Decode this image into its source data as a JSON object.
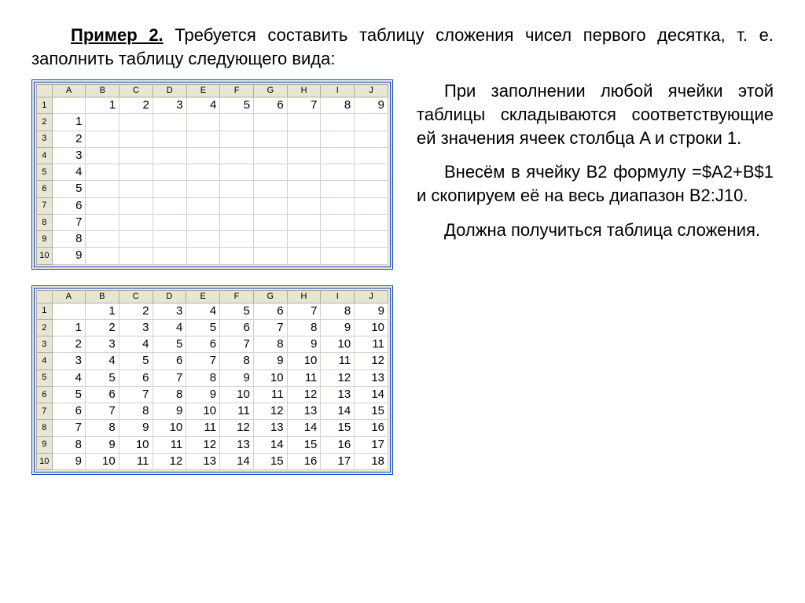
{
  "intro": {
    "example_label": "Пример 2.",
    "text": " Требуется составить таблицу сложения чисел первого десятка, т. е. заполнить таблицу следующего вида:"
  },
  "para1": "При заполнении любой ячейки этой таблицы складываются соответствующие ей значения ячеек столбца A и строки 1.",
  "para2": "Внесём в ячейку B2 формулу =$A2+B$1 и скопируем её на весь диапазон B2:J10.",
  "para3": "Должна получиться таблица сложения.",
  "table1": {
    "columns": [
      "",
      "A",
      "B",
      "C",
      "D",
      "E",
      "F",
      "G",
      "H",
      "I",
      "J"
    ],
    "rows": [
      {
        "h": "1",
        "cells": [
          "",
          "1",
          "2",
          "3",
          "4",
          "5",
          "6",
          "7",
          "8",
          "9"
        ]
      },
      {
        "h": "2",
        "cells": [
          "1",
          "",
          "",
          "",
          "",
          "",
          "",
          "",
          "",
          ""
        ]
      },
      {
        "h": "3",
        "cells": [
          "2",
          "",
          "",
          "",
          "",
          "",
          "",
          "",
          "",
          ""
        ]
      },
      {
        "h": "4",
        "cells": [
          "3",
          "",
          "",
          "",
          "",
          "",
          "",
          "",
          "",
          ""
        ]
      },
      {
        "h": "5",
        "cells": [
          "4",
          "",
          "",
          "",
          "",
          "",
          "",
          "",
          "",
          ""
        ]
      },
      {
        "h": "6",
        "cells": [
          "5",
          "",
          "",
          "",
          "",
          "",
          "",
          "",
          "",
          ""
        ]
      },
      {
        "h": "7",
        "cells": [
          "6",
          "",
          "",
          "",
          "",
          "",
          "",
          "",
          "",
          ""
        ]
      },
      {
        "h": "8",
        "cells": [
          "7",
          "",
          "",
          "",
          "",
          "",
          "",
          "",
          "",
          ""
        ]
      },
      {
        "h": "9",
        "cells": [
          "8",
          "",
          "",
          "",
          "",
          "",
          "",
          "",
          "",
          ""
        ]
      },
      {
        "h": "10",
        "cells": [
          "9",
          "",
          "",
          "",
          "",
          "",
          "",
          "",
          "",
          ""
        ]
      }
    ]
  },
  "table2": {
    "columns": [
      "",
      "A",
      "B",
      "C",
      "D",
      "E",
      "F",
      "G",
      "H",
      "I",
      "J"
    ],
    "rows": [
      {
        "h": "1",
        "cells": [
          "",
          "1",
          "2",
          "3",
          "4",
          "5",
          "6",
          "7",
          "8",
          "9"
        ]
      },
      {
        "h": "2",
        "cells": [
          "1",
          "2",
          "3",
          "4",
          "5",
          "6",
          "7",
          "8",
          "9",
          "10"
        ]
      },
      {
        "h": "3",
        "cells": [
          "2",
          "3",
          "4",
          "5",
          "6",
          "7",
          "8",
          "9",
          "10",
          "11"
        ]
      },
      {
        "h": "4",
        "cells": [
          "3",
          "4",
          "5",
          "6",
          "7",
          "8",
          "9",
          "10",
          "11",
          "12"
        ]
      },
      {
        "h": "5",
        "cells": [
          "4",
          "5",
          "6",
          "7",
          "8",
          "9",
          "10",
          "11",
          "12",
          "13"
        ]
      },
      {
        "h": "6",
        "cells": [
          "5",
          "6",
          "7",
          "8",
          "9",
          "10",
          "11",
          "12",
          "13",
          "14"
        ]
      },
      {
        "h": "7",
        "cells": [
          "6",
          "7",
          "8",
          "9",
          "10",
          "11",
          "12",
          "13",
          "14",
          "15"
        ]
      },
      {
        "h": "8",
        "cells": [
          "7",
          "8",
          "9",
          "10",
          "11",
          "12",
          "13",
          "14",
          "15",
          "16"
        ]
      },
      {
        "h": "9",
        "cells": [
          "8",
          "9",
          "10",
          "11",
          "12",
          "13",
          "14",
          "15",
          "16",
          "17"
        ]
      },
      {
        "h": "10",
        "cells": [
          "9",
          "10",
          "11",
          "12",
          "13",
          "14",
          "15",
          "16",
          "17",
          "18"
        ]
      }
    ]
  }
}
